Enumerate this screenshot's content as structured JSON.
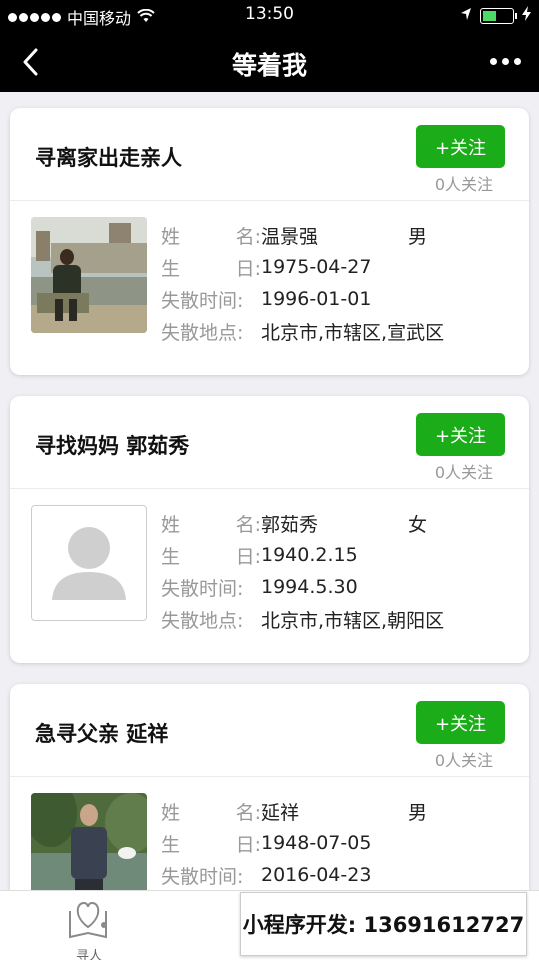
{
  "status_bar": {
    "carrier": "中国移动",
    "time": "13:50"
  },
  "nav": {
    "title": "等着我"
  },
  "labels": {
    "name": [
      "姓",
      "名:"
    ],
    "birth": [
      "生",
      "日:"
    ],
    "lost_time": "失散时间:",
    "lost_place": "失散地点:"
  },
  "cards": [
    {
      "title": "寻离家出走亲人",
      "follow_label": "+关注",
      "follow_count": "0人关注",
      "name": "温景强",
      "gender": "男",
      "birth": "1975-04-27",
      "lost_time": "1996-01-01",
      "lost_place": "北京市,市辖区,宣武区",
      "photo": "photo"
    },
    {
      "title": "寻找妈妈 郭茹秀",
      "follow_label": "+关注",
      "follow_count": "0人关注",
      "name": "郭茹秀",
      "gender": "女",
      "birth": "1940.2.15",
      "lost_time": "1994.5.30",
      "lost_place": "北京市,市辖区,朝阳区",
      "photo": "placeholder-avatar"
    },
    {
      "title": "急寻父亲 延祥",
      "follow_label": "+关注",
      "follow_count": "0人关注",
      "name": "延祥",
      "gender": "男",
      "birth": "1948-07-05",
      "lost_time": "2016-04-23",
      "photo": "photo"
    }
  ],
  "tabbar": {
    "tab1": "寻人"
  },
  "banner": {
    "text": "小程序开发: 13691612727"
  },
  "colors": {
    "accent": "#1aad19",
    "nav_bg": "#000000",
    "page_bg": "#efeff4"
  }
}
